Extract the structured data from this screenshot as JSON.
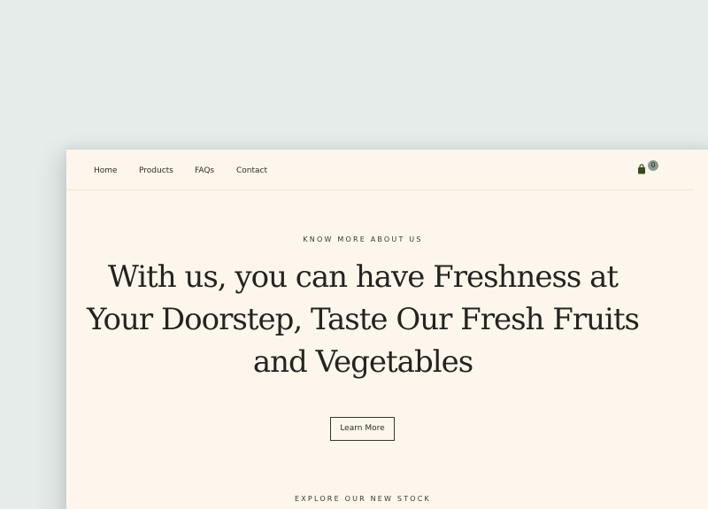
{
  "nav": {
    "items": [
      {
        "label": "Home"
      },
      {
        "label": "Products"
      },
      {
        "label": "FAQs"
      },
      {
        "label": "Contact"
      }
    ],
    "cart": {
      "icon": "shopping-bag-icon",
      "count": "0"
    }
  },
  "hero": {
    "eyebrow": "KNOW MORE ABOUT US",
    "headline": "With us, you can have Freshness at Your Doorstep, Taste Our Fresh Fruits and Vegetables",
    "button_label": "Learn More"
  },
  "next_section": {
    "eyebrow": "EXPLORE OUR NEW STOCK"
  },
  "colors": {
    "page_background": "#e5ecea",
    "site_background": "#fdf6ec",
    "text": "#26231f",
    "cart_icon": "#3b4a1e",
    "badge": "#8c9a95"
  }
}
